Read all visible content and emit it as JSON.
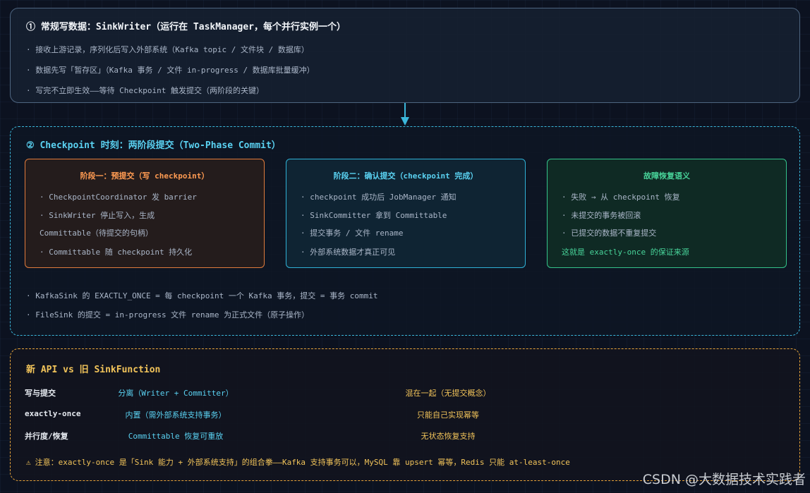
{
  "section1": {
    "title": "① 常规写数据：SinkWriter（运行在 TaskManager，每个并行实例一个）",
    "lines": [
      "· 接收上游记录，序列化后写入外部系统（Kafka topic / 文件块 / 数据库）",
      "· 数据先写「暂存区」（Kafka 事务 / 文件 in-progress / 数据库批量缓冲）",
      "· 写完不立即生效——等待 Checkpoint 触发提交（两阶段的关键）"
    ]
  },
  "section2": {
    "title": "② Checkpoint 时刻：两阶段提交（Two-Phase Commit）",
    "cards": [
      {
        "title": "阶段一：预提交（写 checkpoint）",
        "lines": [
          "· CheckpointCoordinator 发 barrier",
          "· SinkWriter 停止写入，生成",
          "Committable（待提交的句柄）",
          "· Committable 随 checkpoint 持久化"
        ]
      },
      {
        "title": "阶段二：确认提交（checkpoint 完成）",
        "lines": [
          "· checkpoint 成功后 JobManager 通知",
          "· SinkCommitter 拿到 Committable",
          "· 提交事务 / 文件 rename",
          "· 外部系统数据才真正可见"
        ]
      },
      {
        "title": "故障恢复语义",
        "lines": [
          "· 失败 → 从 checkpoint 恢复",
          "· 未提交的事务被回滚",
          "· 已提交的数据不重复提交",
          "这就是 exactly-once 的保证来源"
        ]
      }
    ],
    "footer": [
      "· KafkaSink 的 EXACTLY_ONCE = 每 checkpoint 一个 Kafka 事务，提交 = 事务 commit",
      "· FileSink 的提交 = in-progress 文件 rename 为正式文件（原子操作）"
    ]
  },
  "section3": {
    "title": "新 API vs 旧 SinkFunction",
    "rows": [
      {
        "label": "写与提交",
        "new": "分离（Writer + Committer）",
        "old": "混在一起（无提交概念）"
      },
      {
        "label": "exactly-once",
        "new": "内置（需外部系统支持事务）",
        "old": "只能自己实现幂等"
      },
      {
        "label": "并行度/恢复",
        "new": "Committable 恢复可重放",
        "old": "无状态恢复支持"
      }
    ],
    "note": "注意：exactly-once 是「Sink 能力 + 外部系统支持」的组合拳——Kafka 支持事务可以，MySQL 靠 upsert 幂等，Redis 只能 at-least-once",
    "note_icon": "⚠"
  },
  "watermark": "CSDN @大数据技术实践者",
  "colors": {
    "orange": "#e07b3c",
    "cyan": "#2fb1d6",
    "green": "#34c38a",
    "gold": "#e6a33a"
  }
}
